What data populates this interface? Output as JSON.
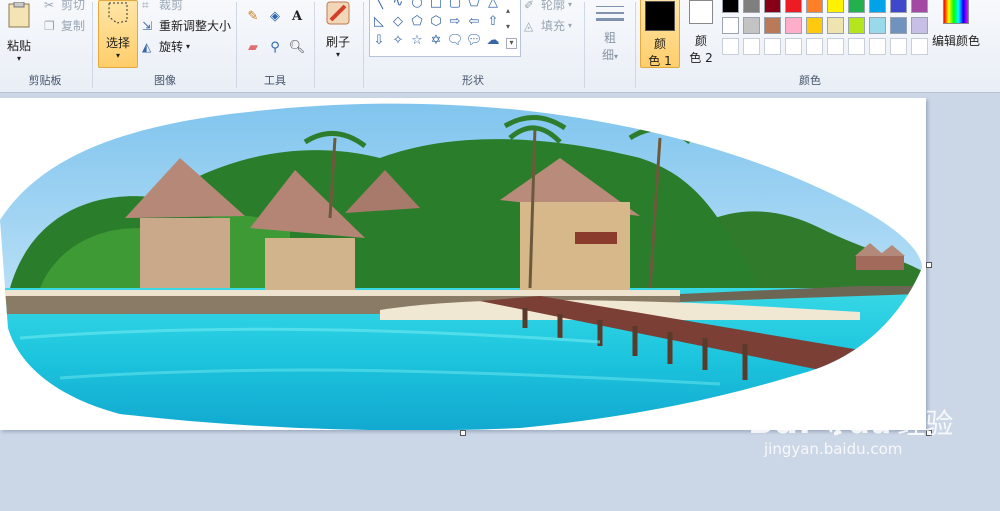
{
  "clipboard": {
    "paste": "粘贴",
    "cut": "剪切",
    "copy": "复制",
    "group": "剪贴板"
  },
  "image": {
    "select": "选择",
    "crop": "裁剪",
    "resize": "重新调整大小",
    "rotate": "旋转",
    "group": "图像"
  },
  "tools": {
    "group": "工具",
    "text_glyph": "A"
  },
  "brushes": {
    "label": "刷子"
  },
  "shapes": {
    "group": "形状",
    "outline": "轮廓",
    "fill": "填充",
    "icons": [
      "line-icon",
      "curve-icon",
      "oval-icon",
      "rectangle-icon",
      "rounded-rectangle-icon",
      "polygon-icon",
      "triangle-icon",
      "right-triangle-icon",
      "diamond-icon",
      "pentagon-icon",
      "hexagon-icon",
      "right-arrow-icon",
      "left-arrow-icon",
      "up-arrow-icon",
      "down-arrow-icon",
      "four-point-star-icon",
      "five-point-star-icon",
      "six-point-star-icon",
      "rounded-callout-icon",
      "oval-callout-icon",
      "cloud-callout-icon"
    ]
  },
  "size": {
    "label_top": "粗",
    "label_bottom": "细"
  },
  "color1": {
    "label_top": "颜",
    "label_bottom": "色 1",
    "value": "#000000"
  },
  "color2": {
    "label_top": "颜",
    "label_bottom": "色 2",
    "value": "#ffffff"
  },
  "colors": {
    "group": "颜色",
    "edit": "编辑颜色",
    "row1": [
      "#000000",
      "#7f7f7f",
      "#880015",
      "#ed1c24",
      "#ff7f27",
      "#fff200",
      "#22b14c",
      "#00a2e8",
      "#3f48cc",
      "#a349a4"
    ],
    "row2": [
      "#ffffff",
      "#c3c3c3",
      "#b97a57",
      "#ffaec9",
      "#ffc90e",
      "#efe4b0",
      "#b5e61d",
      "#99d9ea",
      "#7092be",
      "#c8bfe7"
    ],
    "row3": [
      "#ffffff",
      "#ffffff",
      "#ffffff",
      "#ffffff",
      "#ffffff",
      "#ffffff",
      "#ffffff",
      "#ffffff",
      "#ffffff",
      "#ffffff"
    ]
  },
  "watermark": {
    "brand": "Bai",
    "paw": "du",
    "cn": "经验",
    "url": "jingyan.baidu.com"
  }
}
